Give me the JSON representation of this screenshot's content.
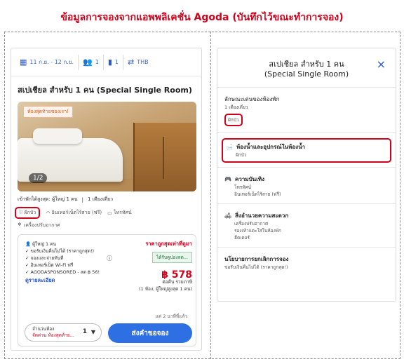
{
  "page_title": "ข้อมูลการจองจากแอพพลิเคชั่น Agoda (บันทึกไว้ขณะทำการจอง)",
  "left": {
    "topbar": {
      "dates": "11 ก.ย. - 12 ก.ย.",
      "guests": "1",
      "rooms": "1",
      "currency": "THB"
    },
    "room_title": "สเปเชียล สำหรับ 1 คน (Special Single Room)",
    "photo": {
      "badge": "ห้องสุดท้ายของเรา!",
      "counter": "1/2"
    },
    "occupancy": "เข้าพักได้สูงสุด: ผู้ใหญ่ 1 คน",
    "bed": "1 เตียงเดี่ยว",
    "amenities": {
      "shower": "ฝักบัว",
      "wifi": "อินเทอร์เน็ตไร้สาย (ฟรี)",
      "tv": "โทรทัศน์",
      "aircon": "เครื่องปรับอากาศ"
    },
    "offer": {
      "adults": "ผู้ใหญ่ 1 คน",
      "lowest_price": "ราคาถูกสุดเท่าที่ดูมา",
      "benefit_1": "ขอรับเงินคืนไม่ได้ (ราคาถูกสุด!)",
      "benefit_2": "จองและจ่ายทันที",
      "benefit_3": "อินเทอร์เน็ต Wi-Fi ฟรี",
      "benefit_4": "AGODASPONSORED - ลด ฿ 56!",
      "coupon": "ได้รับคูปองลด...",
      "price": "฿ 578",
      "per_night": "ต่อคืน รวมภาษี",
      "per_night_sub": "(1 ห้อง, ผู้ใหญ่สูงสุด 1 คน)",
      "details_link": "ดูรายละเอียด",
      "last_booked": "แค่ 2 นาทีที่แล้ว",
      "qty_label": "จำนวนห้อง",
      "qty_sub": "จัดด่วน ห้องสุดท้าย...",
      "qty_value": "1",
      "book_button": "ส่งคำขอจอง"
    }
  },
  "right": {
    "header_line1": "สเปเชียล สำหรับ 1 คน",
    "header_line2": "(Special Single Room)",
    "close": "×",
    "features_title": "ลักษณะเด่นของห้องพัก",
    "features_bed": "1 เตียงเดี่ยว",
    "features_shower": "ฝักบัว",
    "bathroom_title": "ห้องน้ำและอุปกรณ์ในห้องน้ำ",
    "bathroom_item": "ฝักบัว",
    "entertainment_title": "ความบันเทิง",
    "entertainment_items": [
      "โทรทัศน์",
      "อินเทอร์เน็ตไร้สาย (ฟรี)"
    ],
    "comfort_title": "สิ่งอำนวยความสะดวก",
    "comfort_items": [
      "เครื่องปรับอากาศ",
      "รองเท้าแตะใส่ในห้องพัก",
      "ฮีตเตอร์"
    ],
    "cancel_title": "นโยบายการยกเลิกการจอง",
    "cancel_item": "ขอรับเงินคืนไม่ได้ (ราคาถูกสุด!)"
  },
  "colors": {
    "accent_red": "#d0021b",
    "primary_blue": "#2f6fe4"
  }
}
